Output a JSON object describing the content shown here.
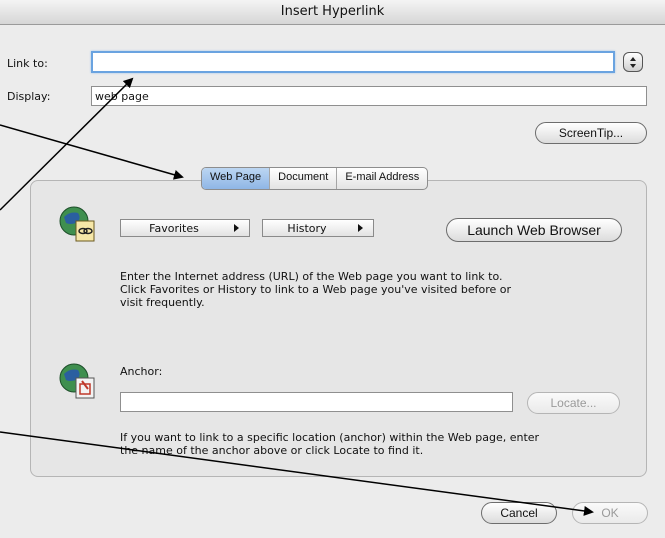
{
  "window": {
    "title": "Insert Hyperlink"
  },
  "link_to": {
    "label": "Link to:",
    "value": ""
  },
  "display": {
    "label": "Display:",
    "value": "web page"
  },
  "buttons": {
    "screentip": "ScreenTip...",
    "launch_browser": "Launch Web Browser",
    "locate": "Locate...",
    "cancel": "Cancel",
    "ok": "OK"
  },
  "tabs": [
    {
      "label": "Web Page",
      "active": true
    },
    {
      "label": "Document",
      "active": false
    },
    {
      "label": "E-mail Address",
      "active": false
    }
  ],
  "web_page": {
    "favorites": "Favorites",
    "history": "History",
    "description": "Enter the Internet address (URL) of the Web page you want to link to. Click Favorites or History to link to a Web page you've visited before or visit frequently.",
    "anchor_label": "Anchor:",
    "anchor_value": "",
    "anchor_description": "If you want to link to a specific location (anchor) within the Web page, enter the name of the anchor above or click Locate to find it."
  },
  "colors": {
    "accent": "#8fb6e6",
    "focus": "#6aa3e0"
  },
  "icons": [
    "globe-link-icon",
    "globe-anchor-icon",
    "popup-stepper-icon"
  ]
}
